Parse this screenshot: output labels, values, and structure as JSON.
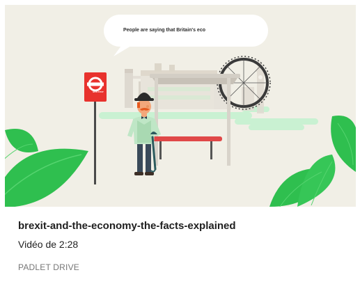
{
  "card": {
    "thumbnail": {
      "speech_bubble": "People are saying that Britain's eco",
      "sign_label": "BUS STOP"
    },
    "title": "brexit-and-the-economy-the-facts-explained",
    "subtitle": "Vidéo de 2:28",
    "source": "PADLET DRIVE"
  },
  "colors": {
    "background": "#f1efe6",
    "leaf_green": "#2fbf4f",
    "sign_red": "#e8322d",
    "bench_red": "#e04848",
    "shirt_green": "#bfe6c6"
  },
  "icons": [
    "umbrella-icon",
    "bus-stop-sign-icon"
  ]
}
